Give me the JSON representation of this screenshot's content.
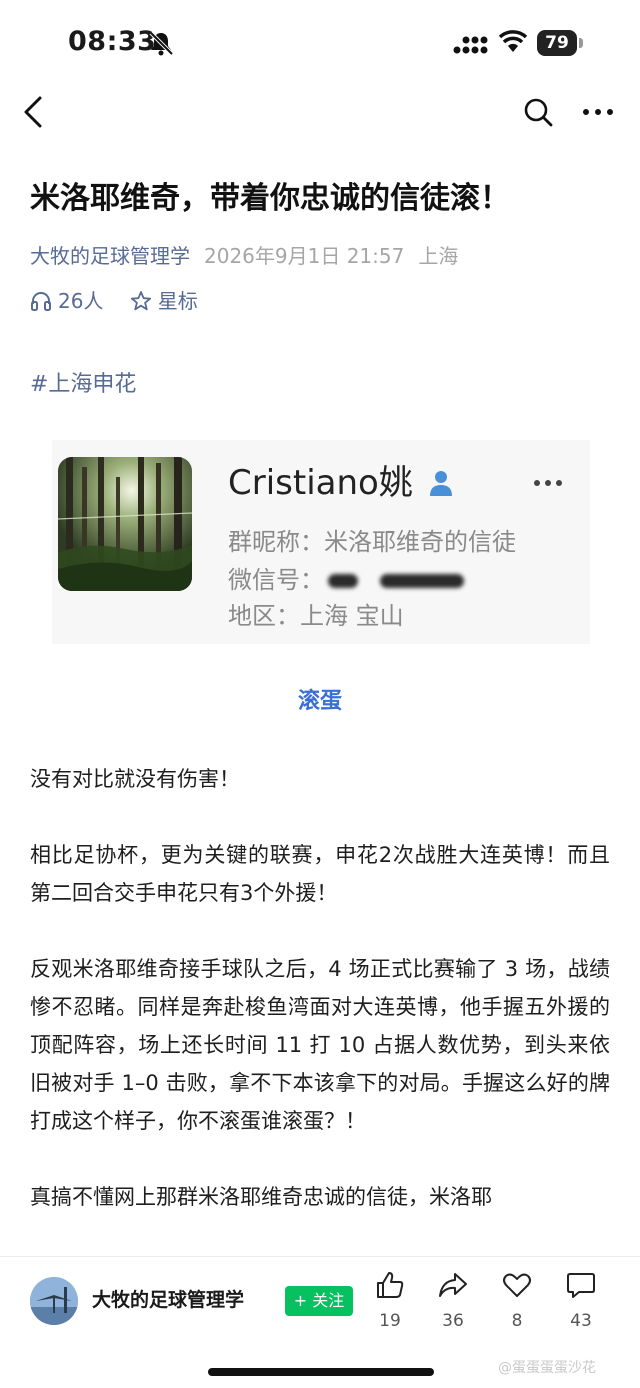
{
  "status_bar": {
    "time": "08:33",
    "battery": "79",
    "icons": [
      "bell-slash-icon",
      "signal-icon",
      "wifi-icon",
      "battery-icon"
    ]
  },
  "nav": {
    "icons": [
      "back-arrow-icon",
      "search-icon",
      "more-dots-icon"
    ]
  },
  "article": {
    "title": "米洛耶维奇，带着你忠诚的信徒滚！",
    "account": "大牧的足球管理学",
    "date": "2026年9月1日 21:57",
    "location": "上海",
    "listen_count": "26人",
    "star_label": "星标",
    "hashtag": "#上海申花"
  },
  "profile_card": {
    "name": "Cristiano姚",
    "group_nickname": "群昵称：米洛耶维奇的信徒",
    "wechat_id_label": "微信号：",
    "region": "地区：上海 宝山",
    "icons": [
      "person-icon",
      "more-dots-icon"
    ]
  },
  "image_caption": "滚蛋",
  "body": {
    "paragraphs": [
      "没有对比就没有伤害！",
      "相比足协杯，更为关键的联赛，申花2次战胜大连英博！而且第二回合交手申花只有3个外援！",
      "反观米洛耶维奇接手球队之后，4 场正式比赛输了 3 场，战绩惨不忍睹。同样是奔赴梭鱼湾面对大连英博，他手握五外援的顶配阵容，场上还长时间 11 打 10 占据人数优势，到头来依旧被对手 1–0 击败，拿不下本该拿下的对局。手握这么好的牌打成这个样子，你不滚蛋谁滚蛋？！",
      "真搞不懂网上那群米洛耶维奇忠诚的信徒，米洛耶"
    ]
  },
  "bottom_bar": {
    "author": "大牧的足球管理学",
    "follow_label": "+ 关注",
    "likes": "19",
    "shares": "36",
    "favorites": "8",
    "comments": "43"
  },
  "watermark": "@蛋蛋蛋蛋沙花",
  "colors": {
    "link": "#576b95",
    "caption": "#3a6fd8",
    "follow": "#07c160",
    "meta_gray": "#a6a6a6"
  }
}
